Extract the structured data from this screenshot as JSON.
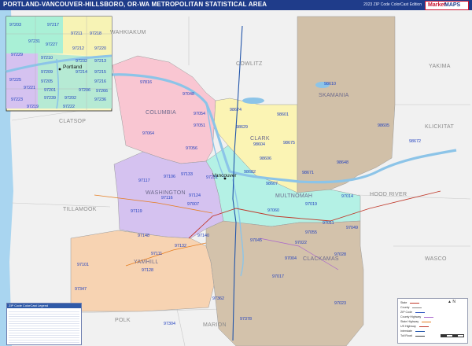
{
  "header": {
    "title": "PORTLAND-VANCOUVER-HILLSBORO, OR-WA METROPOLITAN STATISTICAL AREA",
    "edition": "2023 ZIP Code ColorCast Edition"
  },
  "logo": {
    "mark1": "Market",
    "mark2": "MAPS"
  },
  "counties": {
    "columbia": "COLUMBIA",
    "washington": "WASHINGTON",
    "multnomah": "MULTNOMAH",
    "clackamas": "CLACKAMAS",
    "yamhill": "YAMHILL",
    "clark": "CLARK",
    "skamania": "SKAMANIA",
    "wahkiakum": "WAHKIAKUM",
    "cowlitz": "COWLITZ",
    "yakima": "YAKIMA",
    "klickitat": "KLICKITAT",
    "clatsop": "CLATSOP",
    "tillamook": "TILLAMOOK",
    "hood_river": "HOOD RIVER",
    "wasco": "WASCO",
    "polk": "POLK",
    "marion": "MARION"
  },
  "cities": {
    "vancouver": "Vancouver",
    "portland": "Portland"
  },
  "zips": {
    "z97816": "97816",
    "z97048": "97048",
    "z97054": "97054",
    "z97051": "97051",
    "z97064": "97064",
    "z97056": "97056",
    "z97106": "97106",
    "z97133": "97133",
    "z97117": "97117",
    "z97116": "97116",
    "z97124": "97124",
    "z97119": "97119",
    "z97007": "97007",
    "z97140": "97140",
    "z97148": "97148",
    "z97132": "97132",
    "z97111": "97111",
    "z97128": "97128",
    "z97101": "97101",
    "z97347": "97347",
    "z97304": "97304",
    "z97378": "97378",
    "z97362": "97362",
    "z97023": "97023",
    "z97017": "97017",
    "z97004": "97004",
    "z97045": "97045",
    "z97022": "97022",
    "z97055": "97055",
    "z97028": "97028",
    "z97011": "97011",
    "z97049": "97049",
    "z97019": "97019",
    "z97014": "97014",
    "z97060": "97060",
    "z98671": "98671",
    "z98604": "98604",
    "z98601": "98601",
    "z98629": "98629",
    "z98674": "98674",
    "z98610": "98610",
    "z98605": "98605",
    "z98672": "98672",
    "z98648": "98648",
    "z98675": "98675",
    "z98606": "98606",
    "z98607": "98607",
    "z98616": "98616",
    "z98682": "98682",
    "z98660": "98660",
    "z97231": "97231",
    "z97229": "97229",
    "z97211": "97211",
    "z97217": "97217",
    "z97218": "97218",
    "z97220": "97220",
    "z97232": "97232",
    "z97213": "97213",
    "z97210": "97210",
    "z97227": "97227",
    "z97212": "97212",
    "z97209": "97209",
    "z97205": "97205",
    "z97214": "97214",
    "z97215": "97215",
    "z97216": "97216",
    "z97201": "97201",
    "z97239": "97239",
    "z97202": "97202",
    "z97206": "97206",
    "z97266": "97266",
    "z97236": "97236",
    "z97225": "97225",
    "z97221": "97221",
    "z97219": "97219",
    "z97223": "97223",
    "z97224": "97224",
    "z97222": "97222",
    "z97203": "97203"
  },
  "index_table": {
    "title": "ZIP Code ColorCast Legend"
  },
  "legend": {
    "north": "N",
    "items": [
      {
        "label": "State",
        "color": "#c0392b"
      },
      {
        "label": "County",
        "color": "#888888"
      },
      {
        "label": "ZIP Code",
        "color": "#2a52be"
      },
      {
        "label": "County Highway",
        "color": "#aa66cc"
      },
      {
        "label": "State Highway",
        "color": "#e67e22"
      },
      {
        "label": "US Highway",
        "color": "#c0392b"
      },
      {
        "label": "Interstate",
        "color": "#2255aa"
      },
      {
        "label": "Toll Road",
        "color": "#444444"
      }
    ]
  }
}
